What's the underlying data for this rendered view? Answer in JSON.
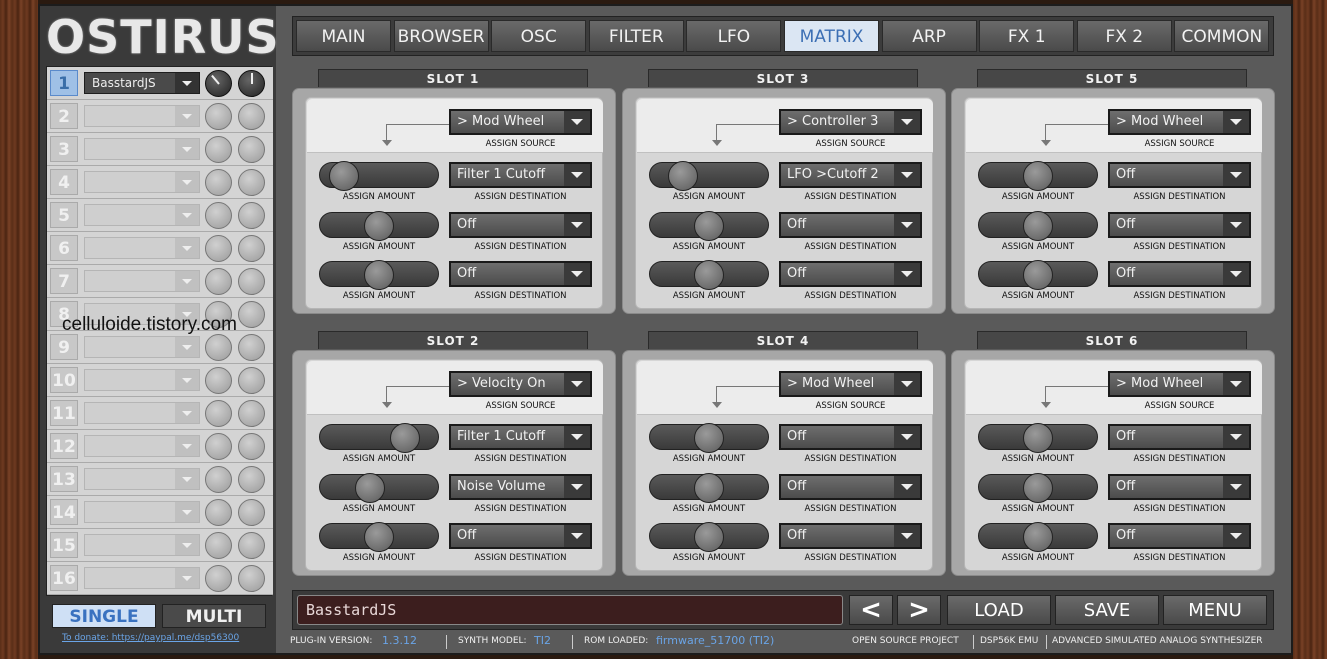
{
  "app": {
    "logo": "OSTIRUS"
  },
  "tabs": [
    {
      "label": "MAIN"
    },
    {
      "label": "BROWSER"
    },
    {
      "label": "OSC"
    },
    {
      "label": "FILTER"
    },
    {
      "label": "LFO"
    },
    {
      "label": "MATRIX",
      "active": true
    },
    {
      "label": "ARP"
    },
    {
      "label": "FX 1"
    },
    {
      "label": "FX 2"
    },
    {
      "label": "COMMON"
    }
  ],
  "parts": [
    {
      "num": "1",
      "preset": "BasstardJS"
    },
    {
      "num": "2",
      "preset": ""
    },
    {
      "num": "3",
      "preset": ""
    },
    {
      "num": "4",
      "preset": ""
    },
    {
      "num": "5",
      "preset": ""
    },
    {
      "num": "6",
      "preset": ""
    },
    {
      "num": "7",
      "preset": ""
    },
    {
      "num": "8",
      "preset": ""
    },
    {
      "num": "9",
      "preset": ""
    },
    {
      "num": "10",
      "preset": ""
    },
    {
      "num": "11",
      "preset": ""
    },
    {
      "num": "12",
      "preset": ""
    },
    {
      "num": "13",
      "preset": ""
    },
    {
      "num": "14",
      "preset": ""
    },
    {
      "num": "15",
      "preset": ""
    },
    {
      "num": "16",
      "preset": ""
    }
  ],
  "watermark": "celluloide.tistory.com",
  "mode": {
    "single": "SINGLE",
    "multi": "MULTI"
  },
  "donate": "To donate: https://paypal.me/dsp56300",
  "labels": {
    "assign_source": "ASSIGN SOURCE",
    "assign_amount": "ASSIGN AMOUNT",
    "assign_destination": "ASSIGN DESTINATION"
  },
  "slots": [
    {
      "title": "SLOT 1",
      "source": "> Mod Wheel",
      "rows": [
        {
          "amount": 0.1,
          "dest": "Filter 1 Cutoff"
        },
        {
          "amount": 0.5,
          "dest": "Off"
        },
        {
          "amount": 0.5,
          "dest": "Off"
        }
      ]
    },
    {
      "title": "SLOT 3",
      "source": "> Controller 3",
      "rows": [
        {
          "amount": 0.2,
          "dest": "LFO >Cutoff 2"
        },
        {
          "amount": 0.5,
          "dest": "Off"
        },
        {
          "amount": 0.5,
          "dest": "Off"
        }
      ]
    },
    {
      "title": "SLOT 5",
      "source": "> Mod Wheel",
      "rows": [
        {
          "amount": 0.5,
          "dest": "Off"
        },
        {
          "amount": 0.5,
          "dest": "Off"
        },
        {
          "amount": 0.5,
          "dest": "Off"
        }
      ]
    },
    {
      "title": "SLOT 2",
      "source": "> Velocity On",
      "rows": [
        {
          "amount": 0.8,
          "dest": "Filter 1 Cutoff"
        },
        {
          "amount": 0.4,
          "dest": "Noise Volume"
        },
        {
          "amount": 0.5,
          "dest": "Off"
        }
      ]
    },
    {
      "title": "SLOT 4",
      "source": "> Mod Wheel",
      "rows": [
        {
          "amount": 0.5,
          "dest": "Off"
        },
        {
          "amount": 0.5,
          "dest": "Off"
        },
        {
          "amount": 0.5,
          "dest": "Off"
        }
      ]
    },
    {
      "title": "SLOT 6",
      "source": "> Mod Wheel",
      "rows": [
        {
          "amount": 0.5,
          "dest": "Off"
        },
        {
          "amount": 0.5,
          "dest": "Off"
        },
        {
          "amount": 0.5,
          "dest": "Off"
        }
      ]
    }
  ],
  "bottom": {
    "patch_name": "BasstardJS",
    "prev": "<",
    "next": ">",
    "load": "LOAD",
    "save": "SAVE",
    "menu": "MENU"
  },
  "status": {
    "plugin_version_label": "PLUG-IN VERSION:",
    "plugin_version": "1.3.12",
    "synth_model_label": "SYNTH MODEL:",
    "synth_model": "TI2",
    "rom_loaded_label": "ROM LOADED:",
    "rom_loaded": "firmware_51700 (TI2)",
    "open_source": "OPEN SOURCE PROJECT",
    "emu": "DSP56K EMU",
    "tagline": "ADVANCED SIMULATED ANALOG SYNTHESIZER"
  }
}
